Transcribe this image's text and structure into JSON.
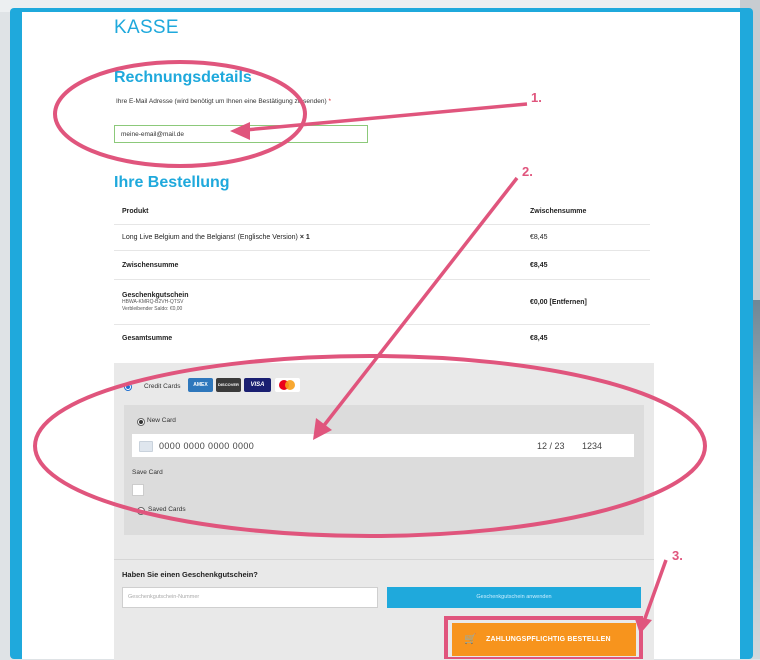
{
  "page": {
    "title": "KASSE"
  },
  "billing": {
    "heading": "Rechnungsdetails",
    "email_label": "Ihre E-Mail Adresse (wird benötigt um Ihnen eine Bestätigung zu senden)",
    "required_mark": "*",
    "email_value": "meine-email@mail.de"
  },
  "order": {
    "heading": "Ihre Bestellung",
    "col_product": "Produkt",
    "col_subtotal": "Zwischensumme",
    "product_name": "Long Live Belgium and the Belgians! (Englische Version)",
    "product_qty": "× 1",
    "product_price": "€8,45",
    "subtotal_label": "Zwischensumme",
    "subtotal_value": "€8,45",
    "gift_label": "Geschenkgutschein",
    "gift_code": "HBWA-KMRQ-B2VH-QTSV",
    "gift_balance": "Verbleibender Saldo: €0,00",
    "gift_value": "€0,00",
    "gift_remove": "[Entfernen]",
    "total_label": "Gesamtsumme",
    "total_value": "€8,45"
  },
  "payment": {
    "method_label": "Credit Cards",
    "logos": [
      "AMEX",
      "DISCOVER",
      "VISA",
      "Mastercard"
    ],
    "new_card_label": "New Card",
    "card_number": "0000 0000 0000 0000",
    "card_expiry": "12 / 23",
    "card_cvc": "1234",
    "save_card_label": "Save Card",
    "saved_cards_label": "Saved Cards"
  },
  "gift": {
    "question": "Haben Sie einen Geschenkgutschein?",
    "input_placeholder": "Geschenkgutschein-Nummer",
    "apply_label": "Geschenkgutschein anwenden"
  },
  "submit": {
    "label": "ZAHLUNGSPFLICHTIG BESTELLEN",
    "icon": "cart-icon"
  },
  "annotations": {
    "step1": "1.",
    "step2": "2.",
    "step3": "3.",
    "color": "#e0557d"
  },
  "colors": {
    "accent": "#1fa9dc",
    "order_button": "#f7941d"
  }
}
